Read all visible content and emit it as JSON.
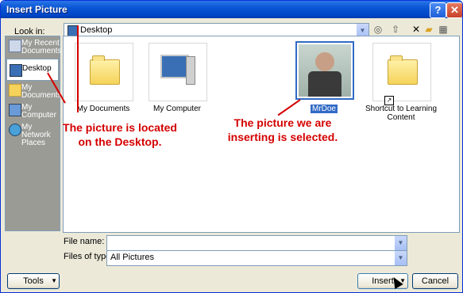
{
  "window": {
    "title": "Insert Picture",
    "help_label": "?",
    "close_label": "✕"
  },
  "lookin": {
    "label": "Look in:",
    "value": "Desktop"
  },
  "places": [
    {
      "label": "My Recent Documents",
      "icon": "recent-documents-icon"
    },
    {
      "label": "Desktop",
      "icon": "desktop-icon",
      "active": true
    },
    {
      "label": "My Documents",
      "icon": "my-documents-icon"
    },
    {
      "label": "My Computer",
      "icon": "my-computer-icon"
    },
    {
      "label": "My Network Places",
      "icon": "network-places-icon"
    }
  ],
  "files": [
    {
      "name": "My Documents",
      "type": "folder"
    },
    {
      "name": "My Computer",
      "type": "computer"
    },
    {
      "name": "MrDoe",
      "type": "picture",
      "selected": true
    },
    {
      "name": "Shortcut to Learning Content",
      "type": "shortcut-folder"
    }
  ],
  "annotations": {
    "desktop_note": "The picture is located on the Desktop.",
    "selected_note": "The picture we are inserting is selected."
  },
  "filename": {
    "label": "File name:",
    "value": ""
  },
  "filetype": {
    "label": "Files of type:",
    "value": "All Pictures"
  },
  "buttons": {
    "tools": "Tools",
    "insert": "Insert",
    "cancel": "Cancel"
  },
  "colors": {
    "annotation": "#d40000",
    "selection": "#316ac5",
    "titlebar": "#0a56d4"
  }
}
